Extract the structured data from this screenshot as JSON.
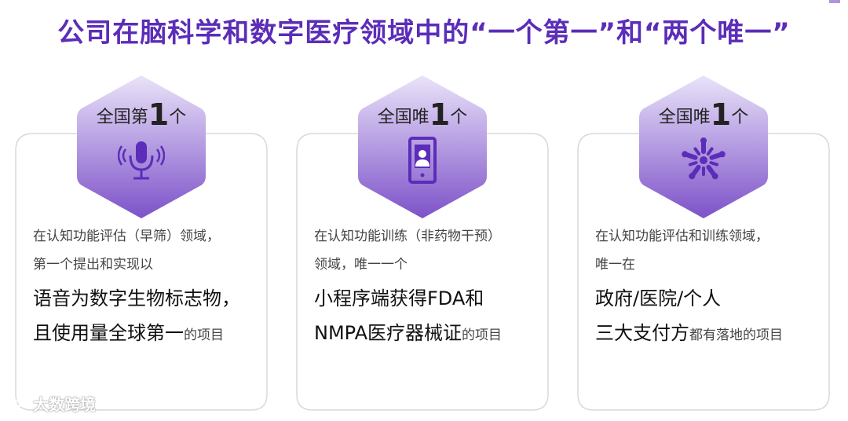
{
  "page": {
    "title": "公司在脑科学和数字医疗领域中的“一个第一”和“两个唯一”"
  },
  "colors": {
    "accent": "#5b2db8",
    "hex_top": "#d9cdf3",
    "hex_bottom": "#7d52c9",
    "icon": "#5b2db8"
  },
  "cards": [
    {
      "badge_prefix": "全国第",
      "badge_number": "1",
      "badge_suffix": "个",
      "icon": "microphone-icon",
      "line1": "在认知功能评估（早筛）领域，",
      "line2": "第一个提出和实现以",
      "line3": "语音为数字生物标志物，",
      "line4_main": "且使用量全球第一",
      "line4_tail": "的项目"
    },
    {
      "badge_prefix": "全国唯",
      "badge_number": "1",
      "badge_suffix": "个",
      "icon": "tablet-user-icon",
      "line1": "在认知功能训练（非药物干预）",
      "line2": "领域，唯一一个",
      "line3": "小程序端获得FDA和",
      "line4_main": "NMPA医疗器械证",
      "line4_tail": "的项目"
    },
    {
      "badge_prefix": "全国唯",
      "badge_number": "1",
      "badge_suffix": "个",
      "icon": "hands-together-icon",
      "line1": "在认知功能评估和训练领域，",
      "line2": "唯一在",
      "line3": "政府/医院/个人",
      "line4_main": "三大支付方",
      "line4_tail": "都有落地的项目"
    }
  ],
  "watermark": {
    "text": "大数跨境"
  }
}
